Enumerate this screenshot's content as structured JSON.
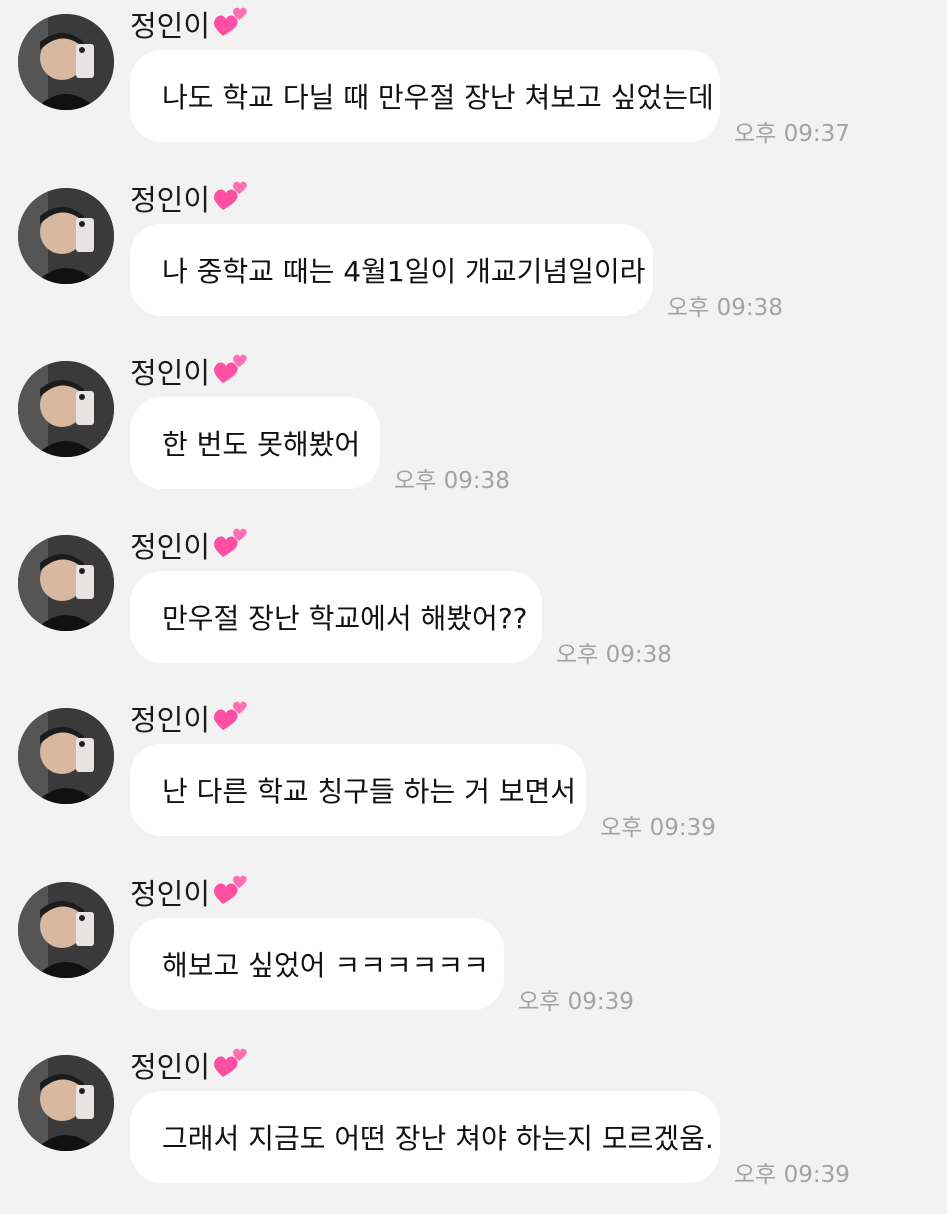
{
  "chat": {
    "messages": [
      {
        "sender": "정인이",
        "text": "나도 학교 다닐 때 만우절 장난 쳐보고 싶었는데",
        "time": "오후 09:37"
      },
      {
        "sender": "정인이",
        "text": "나 중학교 때는 4월1일이 개교기념일이라",
        "time": "오후 09:38"
      },
      {
        "sender": "정인이",
        "text": "한 번도 못해봤어",
        "time": "오후 09:38"
      },
      {
        "sender": "정인이",
        "text": "만우절 장난 학교에서 해봤어??",
        "time": "오후 09:38"
      },
      {
        "sender": "정인이",
        "text": "난 다른 학교 칭구들 하는 거 보면서",
        "time": "오후 09:39"
      },
      {
        "sender": "정인이",
        "text": "해보고 싶었어 ㅋㅋㅋㅋㅋㅋ",
        "time": "오후 09:39"
      },
      {
        "sender": "정인이",
        "text": "그래서 지금도 어떤 장난 쳐야 하는지 모르겠움.",
        "time": "오후 09:39"
      }
    ]
  },
  "icons": {
    "heart": "two-hearts-icon",
    "heart_color": "#ff4fa3"
  },
  "colors": {
    "background": "#f2f2f2",
    "bubble": "#ffffff",
    "time": "#a3a3a3"
  }
}
